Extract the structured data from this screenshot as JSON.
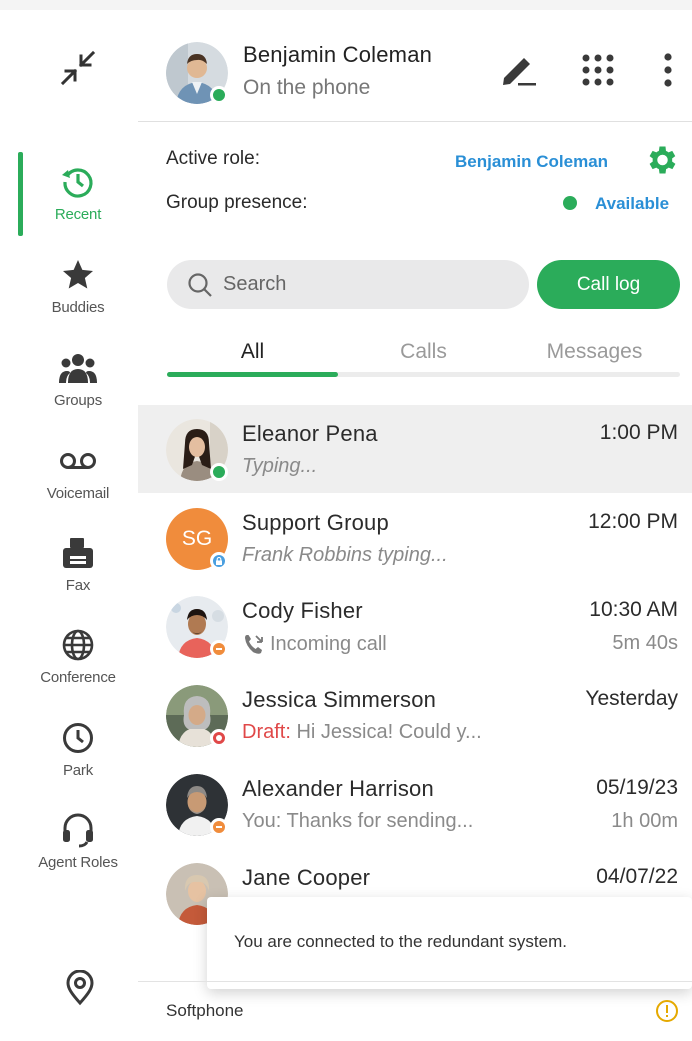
{
  "user": {
    "name": "Benjamin Coleman",
    "status": "On the phone",
    "presence_color": "#2bac5a"
  },
  "colors": {
    "accent": "#2bac5a",
    "link": "#2a8fd6",
    "away": "#f08c3c",
    "busy": "#e04848",
    "info": "#4a9fe0"
  },
  "header_icons": [
    "compose-icon",
    "dialpad-icon",
    "more-vertical-icon"
  ],
  "rail": {
    "items": [
      {
        "label": "Recent",
        "icon": "recent-history-icon",
        "active": true
      },
      {
        "label": "Buddies",
        "icon": "star-icon",
        "active": false
      },
      {
        "label": "Groups",
        "icon": "groups-icon",
        "active": false
      },
      {
        "label": "Voicemail",
        "icon": "voicemail-icon",
        "active": false
      },
      {
        "label": "Fax",
        "icon": "fax-icon",
        "active": false
      },
      {
        "label": "Conference",
        "icon": "globe-icon",
        "active": false
      },
      {
        "label": "Park",
        "icon": "clock-icon",
        "active": false
      },
      {
        "label": "Agent Roles",
        "icon": "headset-icon",
        "active": false
      }
    ]
  },
  "role": {
    "active_role_label": "Active role:",
    "active_role_value": "Benjamin Coleman",
    "group_presence_label": "Group presence:",
    "group_presence_value": "Available"
  },
  "search": {
    "placeholder": "Search"
  },
  "call_log_label": "Call log",
  "tabs": [
    {
      "label": "All",
      "active": true
    },
    {
      "label": "Calls",
      "active": false
    },
    {
      "label": "Messages",
      "active": false
    }
  ],
  "conversations": [
    {
      "name": "Eleanor Pena",
      "sub": "Typing...",
      "time": "1:00 PM",
      "duration": "",
      "status": "available",
      "selected": true
    },
    {
      "name": "Support Group",
      "initials": "SG",
      "sub": "Frank Robbins typing...",
      "time": "12:00 PM",
      "duration": "",
      "status": "group"
    },
    {
      "name": "Cody Fisher",
      "sub": "Incoming call",
      "time": "10:30 AM",
      "duration": "5m 40s",
      "status": "away"
    },
    {
      "name": "Jessica Simmerson",
      "draft_prefix": "Draft:",
      "sub": "Hi Jessica! Could y...",
      "time": "Yesterday",
      "duration": "",
      "status": "busy"
    },
    {
      "name": "Alexander Harrison",
      "sub": "You:  Thanks for sending...",
      "time": "05/19/23",
      "duration": "1h 00m",
      "status": "away"
    },
    {
      "name": "Jane Cooper",
      "sub": "",
      "time": "04/07/22",
      "duration": "",
      "status": "none"
    }
  ],
  "toast": {
    "message": "You are connected to the redundant system."
  },
  "footer": {
    "label": "Softphone",
    "warning_icon": "warning-icon"
  }
}
